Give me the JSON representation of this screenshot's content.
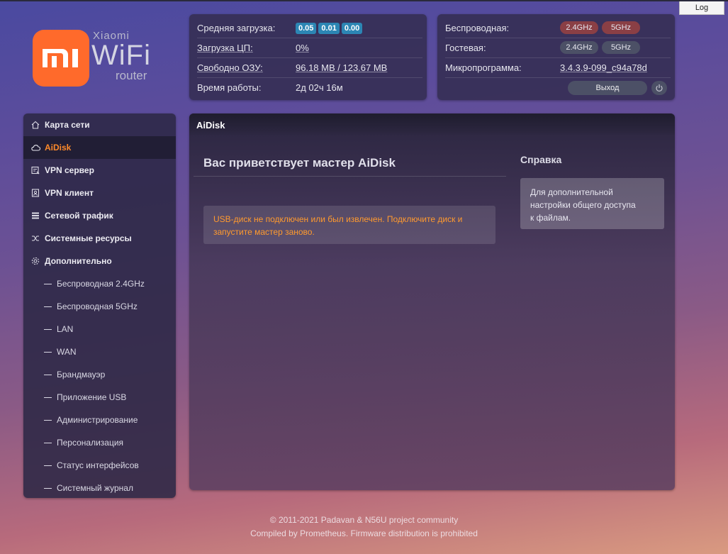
{
  "header": {
    "log_button": "Log",
    "logo": {
      "brand_mark": "MI",
      "line1": "Xiaomi",
      "line2": "WiFi",
      "line3": "router"
    }
  },
  "status": {
    "avg_load_label": "Средняя загрузка:",
    "avg_load": [
      "0.05",
      "0.01",
      "0.00"
    ],
    "cpu_label": "Загрузка ЦП:",
    "cpu_value": "0%",
    "ram_label": "Свободно ОЗУ:",
    "ram_value": "96.18 MB / 123.67 MB",
    "uptime_label": "Время работы:",
    "uptime_value": "2д 02ч 16м"
  },
  "network": {
    "wireless_label": "Беспроводная:",
    "wireless_bands": [
      "2.4GHz",
      "5GHz"
    ],
    "guest_label": "Гостевая:",
    "guest_bands": [
      "2.4GHz",
      "5GHz"
    ],
    "firmware_label": "Микропрограмма:",
    "firmware_value": "3.4.3.9-099_c94a78d",
    "logout_label": "Выход",
    "accent_on": "#8a3f45"
  },
  "sidebar": {
    "items": [
      {
        "label": "Карта сети",
        "icon": "home-icon"
      },
      {
        "label": "AiDisk",
        "icon": "cloud-icon",
        "active": true
      },
      {
        "label": "VPN сервер",
        "icon": "vpn-server-icon"
      },
      {
        "label": "VPN клиент",
        "icon": "vpn-client-icon"
      },
      {
        "label": "Сетевой трафик",
        "icon": "list-icon"
      },
      {
        "label": "Системные ресурсы",
        "icon": "shuffle-icon"
      },
      {
        "label": "Дополнительно",
        "icon": "gear-icon"
      }
    ],
    "subitems": [
      "Беспроводная 2.4GHz",
      "Беспроводная 5GHz",
      "LAN",
      "WAN",
      "Брандмауэр",
      "Приложение USB",
      "Администрирование",
      "Персонализация",
      "Статус интерфейсов",
      "Системный журнал"
    ],
    "active_color": "#ff8a2a"
  },
  "main": {
    "title": "AiDisk",
    "wizard_title": "Вас приветствует мастер AiDisk",
    "alert": "USB-диск не подключен или был извлечен. Подключите диск и запустите мастер заново.",
    "help_title": "Справка",
    "help_text": "Для дополнительной настройки общего доступа к файлам."
  },
  "footer": {
    "line1": "© 2011-2021 Padavan & N56U project community",
    "line2": "Compiled by Prometheus. Firmware distribution is prohibited"
  }
}
